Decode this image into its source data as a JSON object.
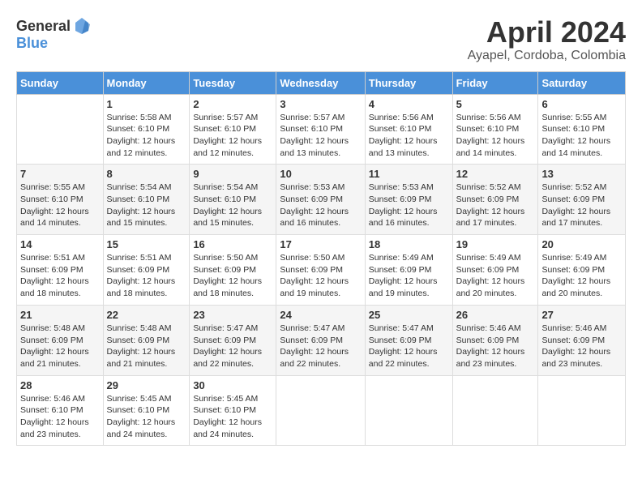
{
  "header": {
    "logo_general": "General",
    "logo_blue": "Blue",
    "month_title": "April 2024",
    "location": "Ayapel, Cordoba, Colombia"
  },
  "calendar": {
    "days_of_week": [
      "Sunday",
      "Monday",
      "Tuesday",
      "Wednesday",
      "Thursday",
      "Friday",
      "Saturday"
    ],
    "weeks": [
      [
        {
          "day": "",
          "info": ""
        },
        {
          "day": "1",
          "info": "Sunrise: 5:58 AM\nSunset: 6:10 PM\nDaylight: 12 hours\nand 12 minutes."
        },
        {
          "day": "2",
          "info": "Sunrise: 5:57 AM\nSunset: 6:10 PM\nDaylight: 12 hours\nand 12 minutes."
        },
        {
          "day": "3",
          "info": "Sunrise: 5:57 AM\nSunset: 6:10 PM\nDaylight: 12 hours\nand 13 minutes."
        },
        {
          "day": "4",
          "info": "Sunrise: 5:56 AM\nSunset: 6:10 PM\nDaylight: 12 hours\nand 13 minutes."
        },
        {
          "day": "5",
          "info": "Sunrise: 5:56 AM\nSunset: 6:10 PM\nDaylight: 12 hours\nand 14 minutes."
        },
        {
          "day": "6",
          "info": "Sunrise: 5:55 AM\nSunset: 6:10 PM\nDaylight: 12 hours\nand 14 minutes."
        }
      ],
      [
        {
          "day": "7",
          "info": "Sunrise: 5:55 AM\nSunset: 6:10 PM\nDaylight: 12 hours\nand 14 minutes."
        },
        {
          "day": "8",
          "info": "Sunrise: 5:54 AM\nSunset: 6:10 PM\nDaylight: 12 hours\nand 15 minutes."
        },
        {
          "day": "9",
          "info": "Sunrise: 5:54 AM\nSunset: 6:10 PM\nDaylight: 12 hours\nand 15 minutes."
        },
        {
          "day": "10",
          "info": "Sunrise: 5:53 AM\nSunset: 6:09 PM\nDaylight: 12 hours\nand 16 minutes."
        },
        {
          "day": "11",
          "info": "Sunrise: 5:53 AM\nSunset: 6:09 PM\nDaylight: 12 hours\nand 16 minutes."
        },
        {
          "day": "12",
          "info": "Sunrise: 5:52 AM\nSunset: 6:09 PM\nDaylight: 12 hours\nand 17 minutes."
        },
        {
          "day": "13",
          "info": "Sunrise: 5:52 AM\nSunset: 6:09 PM\nDaylight: 12 hours\nand 17 minutes."
        }
      ],
      [
        {
          "day": "14",
          "info": "Sunrise: 5:51 AM\nSunset: 6:09 PM\nDaylight: 12 hours\nand 18 minutes."
        },
        {
          "day": "15",
          "info": "Sunrise: 5:51 AM\nSunset: 6:09 PM\nDaylight: 12 hours\nand 18 minutes."
        },
        {
          "day": "16",
          "info": "Sunrise: 5:50 AM\nSunset: 6:09 PM\nDaylight: 12 hours\nand 18 minutes."
        },
        {
          "day": "17",
          "info": "Sunrise: 5:50 AM\nSunset: 6:09 PM\nDaylight: 12 hours\nand 19 minutes."
        },
        {
          "day": "18",
          "info": "Sunrise: 5:49 AM\nSunset: 6:09 PM\nDaylight: 12 hours\nand 19 minutes."
        },
        {
          "day": "19",
          "info": "Sunrise: 5:49 AM\nSunset: 6:09 PM\nDaylight: 12 hours\nand 20 minutes."
        },
        {
          "day": "20",
          "info": "Sunrise: 5:49 AM\nSunset: 6:09 PM\nDaylight: 12 hours\nand 20 minutes."
        }
      ],
      [
        {
          "day": "21",
          "info": "Sunrise: 5:48 AM\nSunset: 6:09 PM\nDaylight: 12 hours\nand 21 minutes."
        },
        {
          "day": "22",
          "info": "Sunrise: 5:48 AM\nSunset: 6:09 PM\nDaylight: 12 hours\nand 21 minutes."
        },
        {
          "day": "23",
          "info": "Sunrise: 5:47 AM\nSunset: 6:09 PM\nDaylight: 12 hours\nand 22 minutes."
        },
        {
          "day": "24",
          "info": "Sunrise: 5:47 AM\nSunset: 6:09 PM\nDaylight: 12 hours\nand 22 minutes."
        },
        {
          "day": "25",
          "info": "Sunrise: 5:47 AM\nSunset: 6:09 PM\nDaylight: 12 hours\nand 22 minutes."
        },
        {
          "day": "26",
          "info": "Sunrise: 5:46 AM\nSunset: 6:09 PM\nDaylight: 12 hours\nand 23 minutes."
        },
        {
          "day": "27",
          "info": "Sunrise: 5:46 AM\nSunset: 6:09 PM\nDaylight: 12 hours\nand 23 minutes."
        }
      ],
      [
        {
          "day": "28",
          "info": "Sunrise: 5:46 AM\nSunset: 6:10 PM\nDaylight: 12 hours\nand 23 minutes."
        },
        {
          "day": "29",
          "info": "Sunrise: 5:45 AM\nSunset: 6:10 PM\nDaylight: 12 hours\nand 24 minutes."
        },
        {
          "day": "30",
          "info": "Sunrise: 5:45 AM\nSunset: 6:10 PM\nDaylight: 12 hours\nand 24 minutes."
        },
        {
          "day": "",
          "info": ""
        },
        {
          "day": "",
          "info": ""
        },
        {
          "day": "",
          "info": ""
        },
        {
          "day": "",
          "info": ""
        }
      ]
    ]
  }
}
